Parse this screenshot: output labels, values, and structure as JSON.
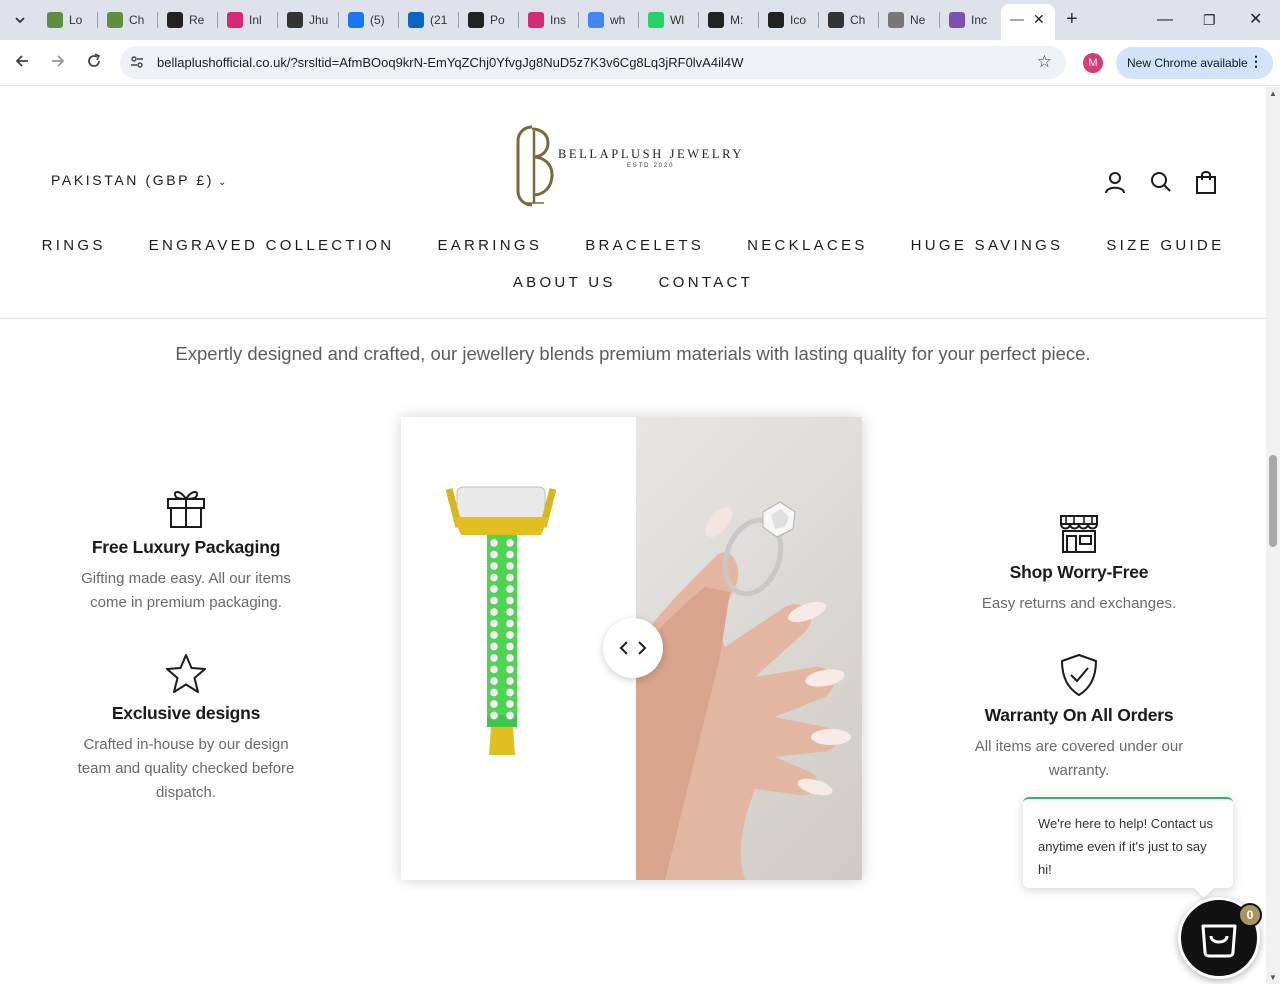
{
  "browser": {
    "tabs": [
      {
        "label": "Lo",
        "icon": "shopify-icon",
        "color": "#5e8e3e"
      },
      {
        "label": "Ch",
        "icon": "shopify-icon",
        "color": "#5e8e3e"
      },
      {
        "label": "Re",
        "icon": "no-sign-icon",
        "color": "#222222"
      },
      {
        "label": "Inl",
        "icon": "instagram-icon",
        "color": "#d62976"
      },
      {
        "label": "Jhu",
        "icon": "ns-icon",
        "color": "#333333"
      },
      {
        "label": "(5)",
        "icon": "facebook-icon",
        "color": "#1877f2"
      },
      {
        "label": "(21",
        "icon": "linkedin-icon",
        "color": "#0a66c2"
      },
      {
        "label": "Po",
        "icon": "threads-icon",
        "color": "#222222"
      },
      {
        "label": "Ins",
        "icon": "instagram-icon",
        "color": "#d62976"
      },
      {
        "label": "wh",
        "icon": "google-icon",
        "color": "#4285f4"
      },
      {
        "label": "Wl",
        "icon": "whatsapp-icon",
        "color": "#25d366"
      },
      {
        "label": "M:",
        "icon": "no-sign-icon",
        "color": "#222222"
      },
      {
        "label": "Ico",
        "icon": "threads-icon",
        "color": "#222222"
      },
      {
        "label": "Ch",
        "icon": "ns-icon",
        "color": "#333333"
      },
      {
        "label": "Ne",
        "icon": "chrome-icon",
        "color": "#777777"
      },
      {
        "label": "Inc",
        "icon": "bootstrap-icon",
        "color": "#7952b3"
      }
    ],
    "url": "bellaplushofficial.co.uk/?srsltid=AfmBOoq9krN-EmYqZChj0YfvgJg8NuD5z7K3v6Cg8Lq3jRF0lvA4il4W",
    "profile_initial": "M",
    "update_label": "New Chrome available"
  },
  "header": {
    "currency": "PAKISTAN (GBP £)",
    "logo_name": "BELLAPLUSH JEWELRY",
    "logo_estd": "ESTD 2020",
    "nav_row1": [
      "RINGS",
      "ENGRAVED COLLECTION",
      "EARRINGS",
      "BRACELETS",
      "NECKLACES",
      "HUGE SAVINGS",
      "SIZE GUIDE"
    ],
    "nav_row2": [
      "ABOUT US",
      "CONTACT"
    ]
  },
  "main": {
    "tagline": "Expertly designed and crafted, our jewellery blends premium materials with lasting quality for your perfect piece.",
    "features_left": [
      {
        "icon": "gift-icon",
        "title": "Free Luxury Packaging",
        "text": "Gifting made easy. All our items come in premium packaging."
      },
      {
        "icon": "star-icon",
        "title": "Exclusive designs",
        "text": "Crafted in-house by our design team and quality checked before dispatch."
      }
    ],
    "features_right": [
      {
        "icon": "store-icon",
        "title": "Shop Worry-Free",
        "text": "Easy returns and exchanges."
      },
      {
        "icon": "shield-check-icon",
        "title": "Warranty On All Orders",
        "text": "All items are covered under our warranty."
      }
    ]
  },
  "chat": {
    "message": "We're here to help! Contact us anytime even if it's just to say hi!",
    "badge_count": "0"
  },
  "colors": {
    "brand_gold": "#7a6a3a",
    "chat_accent": "#2fb47c",
    "badge": "#a8955f"
  }
}
